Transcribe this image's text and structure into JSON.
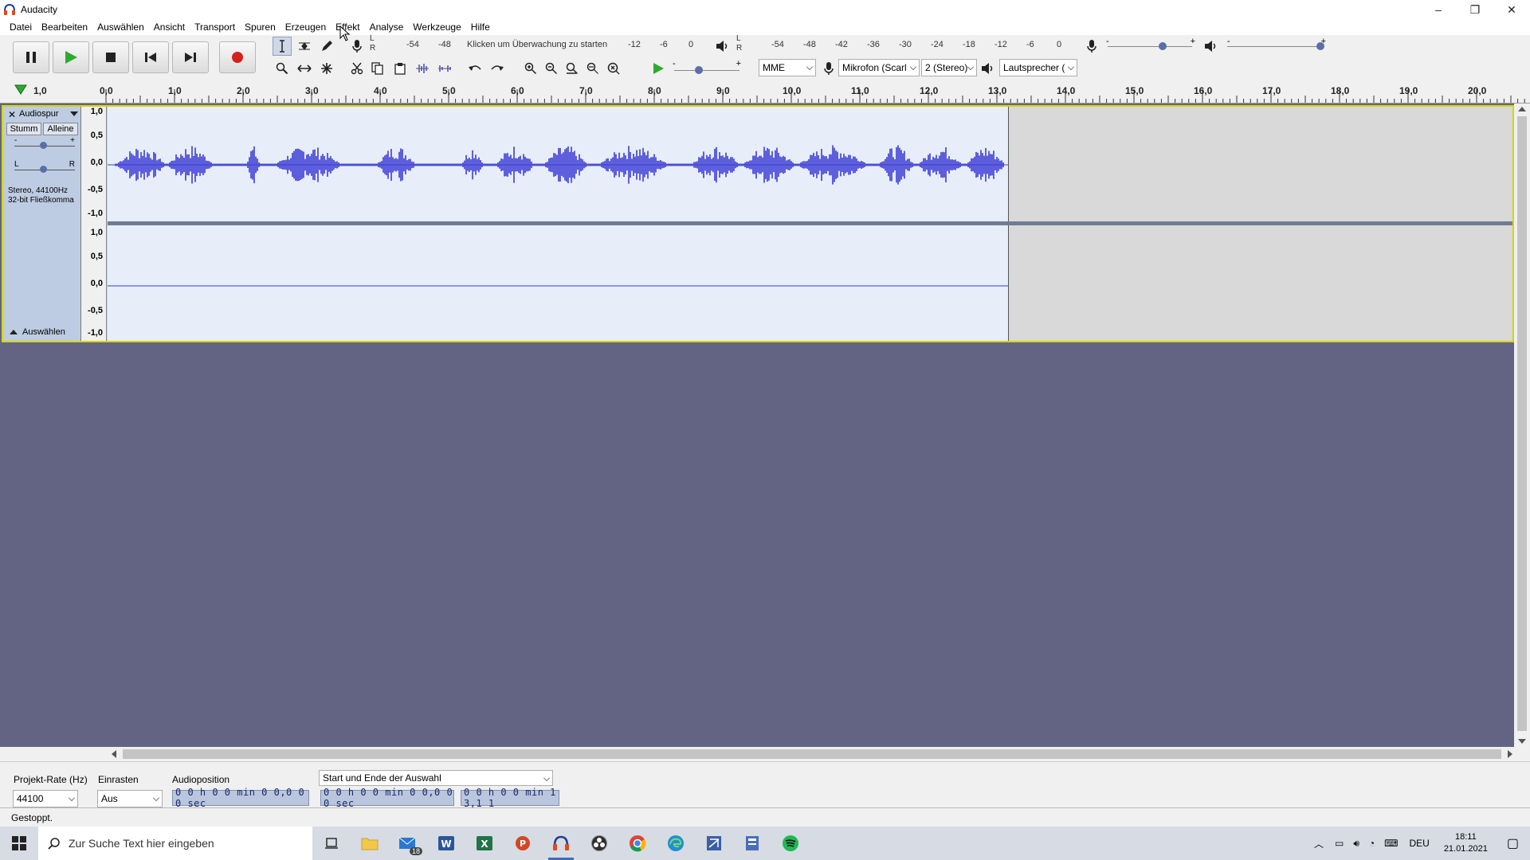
{
  "window": {
    "title": "Audacity",
    "controls": [
      "–",
      "❐",
      "✕"
    ]
  },
  "menu": {
    "items": [
      "Datei",
      "Bearbeiten",
      "Auswählen",
      "Ansicht",
      "Transport",
      "Spuren",
      "Erzeugen",
      "Effekt",
      "Analyse",
      "Werkzeuge",
      "Hilfe"
    ]
  },
  "recording_meter": {
    "ticks": [
      "-54",
      "-48"
    ],
    "hint": "Klicken um Überwachung zu starten",
    "ticks_right": [
      "-12",
      "-6",
      "0"
    ],
    "lr": [
      "L",
      "R"
    ]
  },
  "playback_meter": {
    "ticks": [
      "-54",
      "-48",
      "-42",
      "-36",
      "-30",
      "-24",
      "-18",
      "-12",
      "-6",
      "0"
    ],
    "lr": [
      "L",
      "R"
    ]
  },
  "mixer": {
    "minus": "-",
    "plus": "+"
  },
  "devices": {
    "host": "MME",
    "input": "Mikrofon (Scarl",
    "channels": "2 (Stereo)",
    "output": "Lautsprecher ("
  },
  "timeline": {
    "start_label": "1,0",
    "labels": [
      "0,0",
      "1,0",
      "2,0",
      "3,0",
      "4,0",
      "5,0",
      "6,0",
      "7,0",
      "8,0",
      "9,0",
      "10,0",
      "11,0",
      "12,0",
      "13,0",
      "14,0",
      "15,0",
      "16,0",
      "17,0",
      "18,0",
      "19,0",
      "20,0"
    ]
  },
  "track": {
    "name": "Audiospur",
    "mute": "Stumm",
    "solo": "Alleine",
    "gain_minus": "-",
    "gain_plus": "+",
    "pan_l": "L",
    "pan_r": "R",
    "info_line1": "Stereo, 44100Hz",
    "info_line2": "32-bit Fließkomma",
    "select": "Auswählen",
    "vruler_top": [
      "1,0",
      "0,5",
      "0,0",
      "-0,5",
      "-1,0"
    ],
    "vruler_bottom": [
      "1,0",
      "0,5",
      "0,0",
      "-0,5",
      "-1,0"
    ]
  },
  "selection_toolbar": {
    "rate_label": "Projekt-Rate (Hz)",
    "rate_value": "44100",
    "snap_label": "Einrasten",
    "snap_value": "Aus",
    "position_label": "Audioposition",
    "position_value": "0 0 h 0 0 min 0 0,0 0 0 sec",
    "range_mode": "Start und Ende der Auswahl",
    "start_value": "0 0 h 0 0 min 0 0,0 0 0 sec",
    "end_value": "0 0 h 0 0 min 1 3,1 1"
  },
  "status": {
    "text": "Gestoppt."
  },
  "taskbar": {
    "search_placeholder": "Zur Suche Text hier eingeben",
    "mail_badge": "18",
    "language": "DEU",
    "time": "18:11",
    "date": "21.01.2021"
  },
  "colors": {
    "waveform": "#3b3bd4",
    "track_bg": "#e7eefa",
    "background": "#636483",
    "selection_border": "#d6d600"
  }
}
